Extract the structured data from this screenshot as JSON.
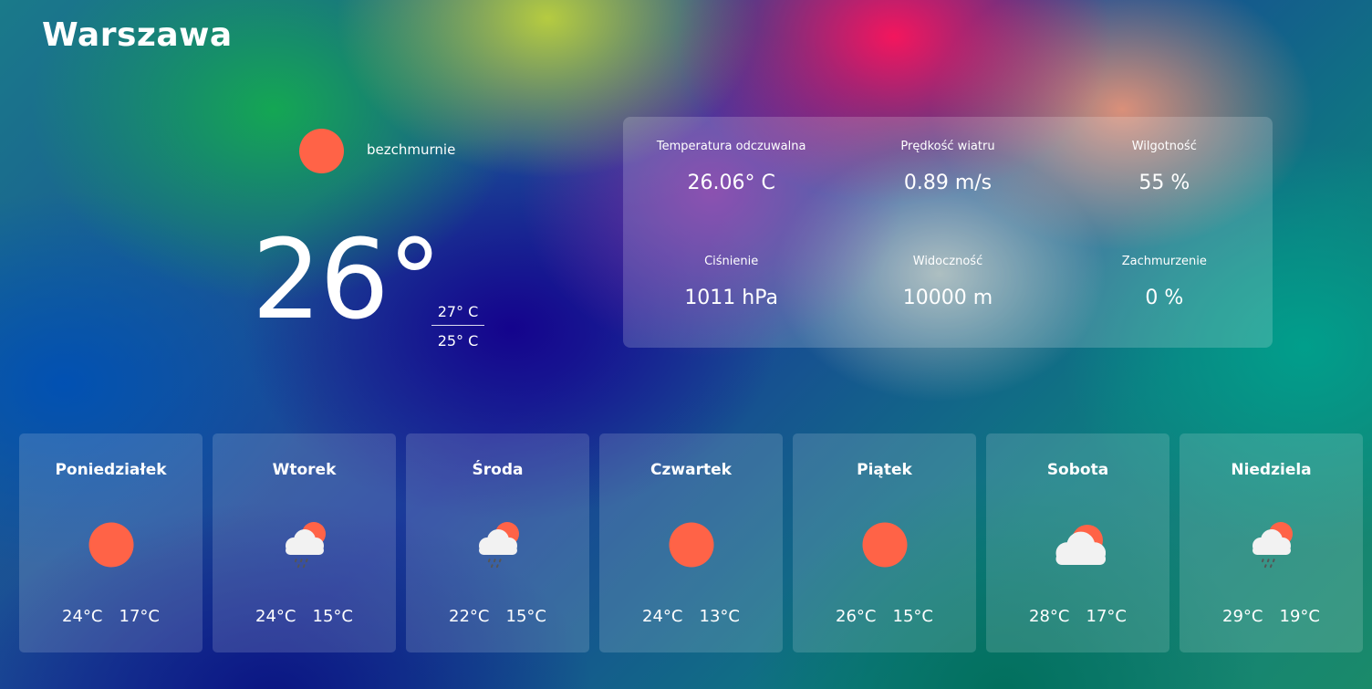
{
  "city": "Warszawa",
  "current": {
    "description": "bezchmurnie",
    "icon": "sun-icon",
    "temp": "26°",
    "max": "27° C",
    "min": "25° C"
  },
  "details": [
    {
      "label": "Temperatura odczuwalna",
      "value": "26.06° C"
    },
    {
      "label": "Prędkość wiatru",
      "value": "0.89 m/s"
    },
    {
      "label": "Wilgotność",
      "value": "55 %"
    },
    {
      "label": "Ciśnienie",
      "value": "1011 hPa"
    },
    {
      "label": "Widoczność",
      "value": "10000 m"
    },
    {
      "label": "Zachmurzenie",
      "value": "0 %"
    }
  ],
  "forecast": [
    {
      "day": "Poniedziałek",
      "icon": "sun-icon",
      "max": "24°C",
      "min": "17°C"
    },
    {
      "day": "Wtorek",
      "icon": "sun-cloud-rain-icon",
      "max": "24°C",
      "min": "15°C"
    },
    {
      "day": "Środa",
      "icon": "sun-cloud-rain-icon",
      "max": "22°C",
      "min": "15°C"
    },
    {
      "day": "Czwartek",
      "icon": "sun-icon",
      "max": "24°C",
      "min": "13°C"
    },
    {
      "day": "Piątek",
      "icon": "sun-icon",
      "max": "26°C",
      "min": "15°C"
    },
    {
      "day": "Sobota",
      "icon": "sun-cloud-icon",
      "max": "28°C",
      "min": "17°C"
    },
    {
      "day": "Niedziela",
      "icon": "sun-cloud-rain-icon",
      "max": "29°C",
      "min": "19°C"
    }
  ],
  "colors": {
    "sun": "#ff6347",
    "cloud": "#f2f2f2",
    "rain": "#555555"
  }
}
